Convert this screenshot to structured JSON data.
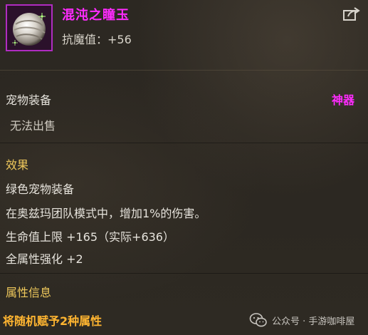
{
  "item": {
    "name": "混沌之瞳玉",
    "stat_text": "抗魔值：+56",
    "icon": "chaos-eye-orb-icon",
    "name_color": "#ff2bff"
  },
  "category": {
    "label": "宠物装备",
    "rarity": "神器",
    "trade": "无法出售"
  },
  "effect": {
    "heading": "效果",
    "lines": [
      "绿色宠物装备",
      "在奥兹玛团队模式中，增加1%的伤害。",
      "生命值上限 +165（实际+636）",
      "全属性强化 +2"
    ]
  },
  "attributes": {
    "heading": "属性信息",
    "random_text": "将随机赋予2种属性"
  },
  "watermark": {
    "text": "公众号 · 手游咖啡屋",
    "icon": "wechat-icon"
  },
  "colors": {
    "gold_heading": "#f0c95c",
    "rarity_pink": "#ff2bff",
    "orange_note": "#ffb531"
  }
}
